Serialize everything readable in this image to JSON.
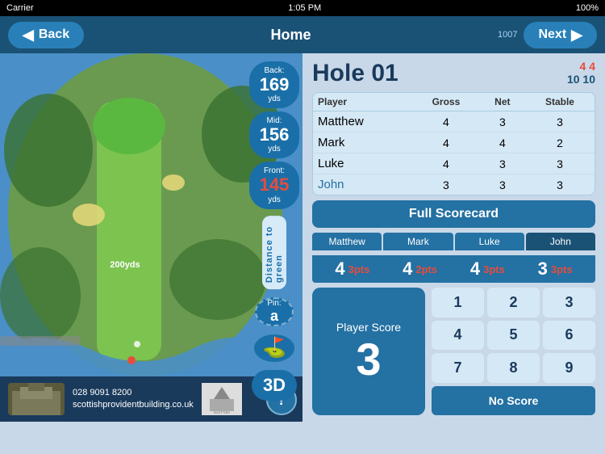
{
  "status_bar": {
    "carrier": "Carrier",
    "wifi": "wifi-icon",
    "time": "1:05 PM",
    "battery": "100%"
  },
  "nav": {
    "back_label": "Back",
    "home_label": "Home",
    "next_label": "Next",
    "next_number": "1007"
  },
  "hole": {
    "title": "Hole 01",
    "score_red_top": "4  4",
    "score_blue_top": "10  10"
  },
  "distances": {
    "back_label": "Back:",
    "back_value": "169",
    "back_unit": "yds",
    "mid_label": "Mid:",
    "mid_value": "156",
    "mid_unit": "yds",
    "front_label": "Front:",
    "front_value": "145",
    "front_unit": "yds",
    "distance_to_green": "Distance to green",
    "pin_label": "Pin:",
    "pin_letter": "a"
  },
  "map_label": "200yds",
  "players": [
    {
      "name": "Matthew",
      "gross": "4",
      "net": "3",
      "stable": "3",
      "highlight": false
    },
    {
      "name": "Mark",
      "gross": "4",
      "net": "4",
      "stable": "2",
      "highlight": false
    },
    {
      "name": "Luke",
      "gross": "4",
      "net": "3",
      "stable": "3",
      "highlight": false
    },
    {
      "name": "John",
      "gross": "3",
      "net": "3",
      "stable": "3",
      "highlight": true
    }
  ],
  "table_headers": {
    "player": "Player",
    "gross": "Gross",
    "net": "Net",
    "stable": "Stable"
  },
  "scorecard_btn": "Full Scorecard",
  "player_tabs": [
    "Matthew",
    "Mark",
    "Luke",
    "John"
  ],
  "active_tab": 3,
  "score_row": [
    {
      "main": "4",
      "pts": "3pts"
    },
    {
      "main": "4",
      "pts": "2pts"
    },
    {
      "main": "4",
      "pts": "3pts"
    },
    {
      "main": "3",
      "pts": "3pts"
    }
  ],
  "player_score": {
    "label": "Player Score",
    "value": "3"
  },
  "numpad": {
    "rows": [
      [
        "1",
        "2",
        "3"
      ],
      [
        "4",
        "5",
        "6"
      ],
      [
        "7",
        "8",
        "9"
      ]
    ],
    "no_score": "No Score"
  },
  "bottom_bar": {
    "phone": "028 9091 8200",
    "website": "scottishprovidentbuilding.co.uk",
    "logo_text": "SCOTTISH PROVIDENT"
  }
}
